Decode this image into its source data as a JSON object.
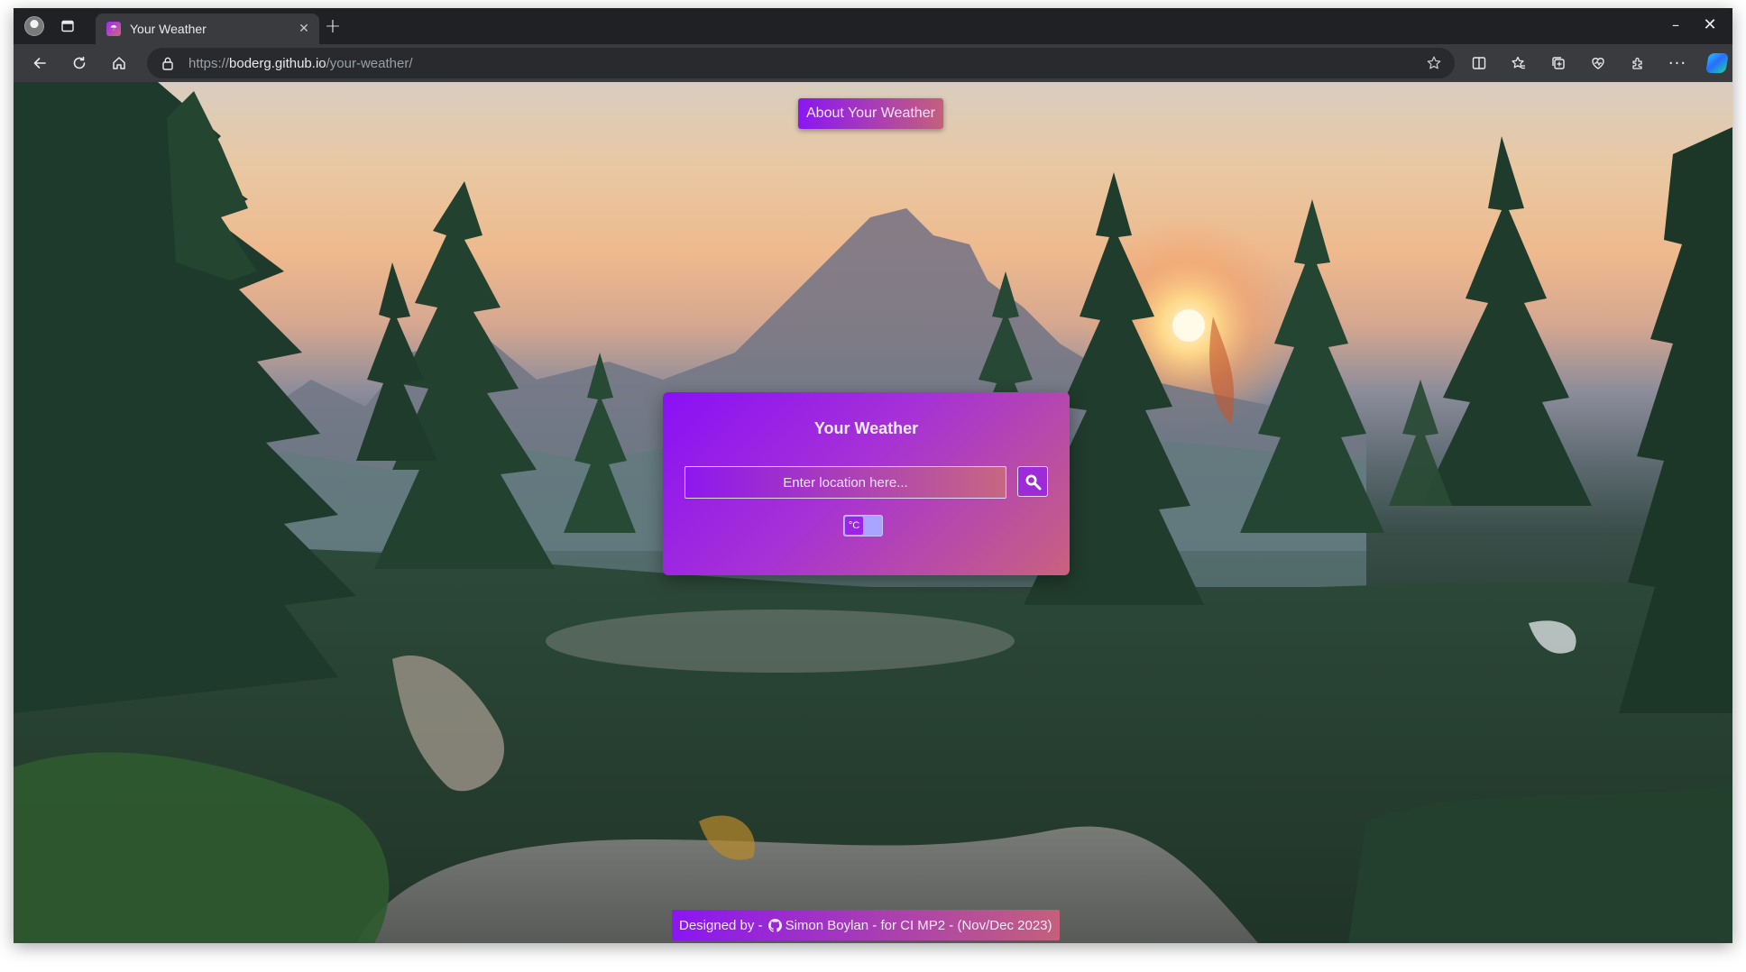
{
  "browser": {
    "tab": {
      "title": "Your Weather"
    },
    "address": {
      "scheme": "https://",
      "host": "boderg.github.io",
      "path": "/your-weather/"
    }
  },
  "page": {
    "about_button": "About Your Weather",
    "card": {
      "title": "Your Weather",
      "search_placeholder": "Enter location here...",
      "unit_label": "°C"
    },
    "footer": {
      "prefix": "Designed by -",
      "author": "Simon Boylan",
      "suffix": "- for CI MP2 - (Nov/Dec 2023)"
    }
  },
  "colors": {
    "accent_start": "#8a16f2",
    "accent_end": "#c4607c",
    "chrome_dark": "#202124",
    "toolbar": "#3a3b3e"
  }
}
